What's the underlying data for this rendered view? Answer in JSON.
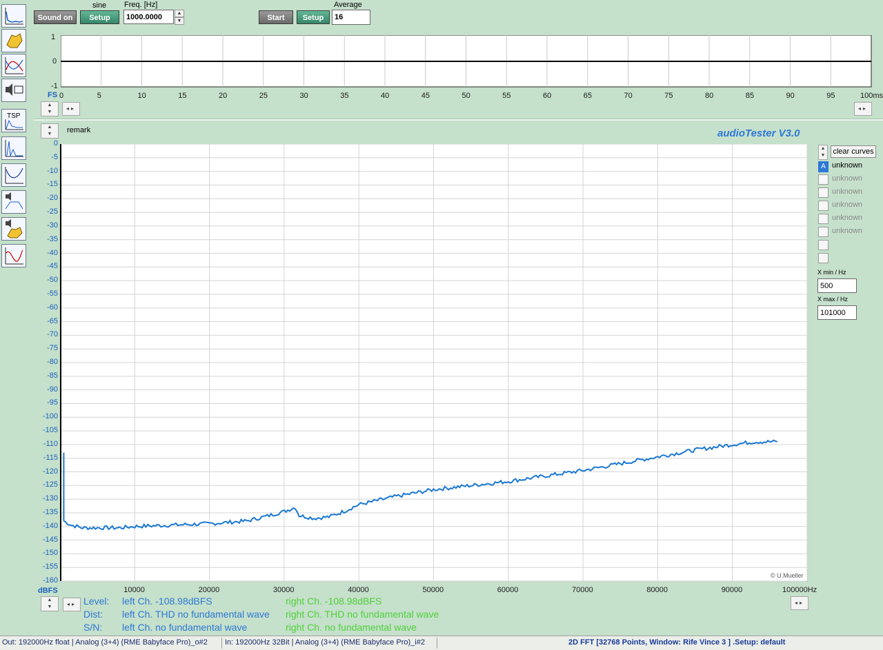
{
  "generator": {
    "sound_on_label": "Sound on",
    "waveform": "sine",
    "setup_label": "Setup",
    "freq_label": "Freq. [Hz]",
    "freq_value": "1000.0000"
  },
  "analyzer": {
    "start_label": "Start",
    "setup_label": "Setup",
    "average_label": "Average",
    "average_value": "16"
  },
  "scope": {
    "y_ticks": [
      "1",
      "0",
      "-1"
    ],
    "fs_label": "FS",
    "x_ticks": [
      "0",
      "5",
      "10",
      "15",
      "20",
      "25",
      "30",
      "35",
      "40",
      "45",
      "50",
      "55",
      "60",
      "65",
      "70",
      "75",
      "80",
      "85",
      "90",
      "95",
      "100ms"
    ]
  },
  "fft_panel": {
    "remark_label": "remark",
    "brand": "audioTester  V3.0",
    "copyright": "© U.Mueller",
    "y_unit": "dBFS",
    "x_unit_last": "100000Hz"
  },
  "curves": {
    "clear_label": "clear curves",
    "active_marker": "A",
    "items": [
      "unknown",
      "unknown",
      "unknown",
      "unknown",
      "unknown",
      "unknown"
    ],
    "xmin_label": "X min / Hz",
    "xmin_value": "500",
    "xmax_label": "X max / Hz",
    "xmax_value": "101000"
  },
  "readouts": {
    "level_label": "Level:",
    "dist_label": "Dist:",
    "sn_label": "S/N:",
    "left_level": "left Ch. -108.98dBFS",
    "right_level": "right Ch. -108.98dBFS",
    "left_dist": "left Ch. THD no fundamental wave",
    "right_dist": "right Ch. THD no fundamental wave",
    "left_sn": "left Ch.  no fundamental wave",
    "right_sn": "right Ch.  no fundamental wave"
  },
  "status": {
    "out": "Out: 192000Hz float  | Analog (3+4) (RME Babyface Pro)_o#2",
    "in": "In: 192000Hz 32Bit  | Analog (3+4) (RME Babyface Pro)_i#2",
    "mode": "2D FFT [32768 Points, Window: Rife Vince 3 ]  .Setup:  default"
  },
  "colors": {
    "background": "#c5e0cb",
    "trace": "#1a78d2",
    "label_blue": "#2e78d6",
    "label_green": "#4fd13a",
    "status_text": "#1a3a9a"
  },
  "chart_data": [
    {
      "type": "line",
      "title": "",
      "xlabel": "ms",
      "ylabel": "FS",
      "xlim": [
        0,
        100
      ],
      "ylim": [
        -1,
        1
      ],
      "grid": true,
      "series": [
        {
          "x": [
            0,
            100
          ],
          "y": [
            0,
            0
          ]
        }
      ]
    },
    {
      "type": "line",
      "title": "",
      "xlabel": "Hz",
      "ylabel": "dBFS",
      "xlim": [
        0,
        100000
      ],
      "ylim": [
        -160,
        0
      ],
      "x_ticks": [
        10000,
        20000,
        30000,
        40000,
        50000,
        60000,
        70000,
        80000,
        90000,
        100000
      ],
      "y_ticks": [
        0,
        -5,
        -10,
        -15,
        -20,
        -25,
        -30,
        -35,
        -40,
        -45,
        -50,
        -55,
        -60,
        -65,
        -70,
        -75,
        -80,
        -85,
        -90,
        -95,
        -100,
        -105,
        -110,
        -115,
        -120,
        -125,
        -130,
        -135,
        -140,
        -145,
        -150,
        -155,
        -160
      ],
      "grid": true,
      "series": [
        {
          "x": [
            500,
            1500,
            3000,
            5000,
            8000,
            10000,
            15000,
            20000,
            25000,
            28000,
            30000,
            31500,
            32000,
            34000,
            36000,
            38000,
            40000,
            45000,
            50000,
            55000,
            60000,
            65000,
            70000,
            75000,
            80000,
            85000,
            90000,
            93000,
            96000
          ],
          "y": [
            -138,
            -139.5,
            -140.5,
            -140.5,
            -140.5,
            -140,
            -139.5,
            -139,
            -138,
            -136,
            -134.5,
            -133,
            -136,
            -137,
            -136.5,
            -134.5,
            -132,
            -129,
            -126.5,
            -125,
            -123.5,
            -121.5,
            -119.5,
            -117,
            -114.5,
            -112,
            -110,
            -109,
            -109
          ]
        }
      ]
    }
  ]
}
